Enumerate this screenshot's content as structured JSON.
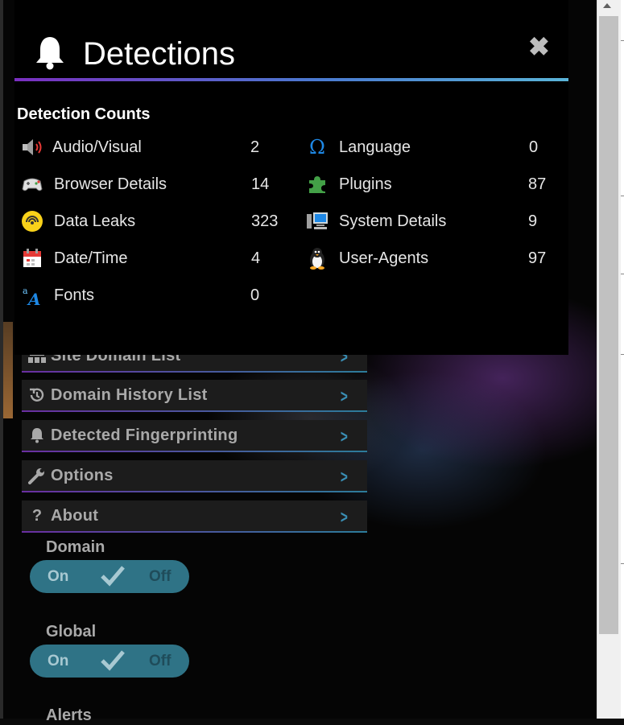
{
  "background_menu": {
    "items": [
      {
        "label": "Site Domain List",
        "icon": "sitemap-icon"
      },
      {
        "label": "Domain History List",
        "icon": "history-icon"
      },
      {
        "label": "Detected Fingerprinting",
        "icon": "bell-icon"
      },
      {
        "label": "Options",
        "icon": "wrench-icon"
      },
      {
        "label": "About",
        "icon": "question-icon"
      }
    ],
    "toggles": [
      {
        "label": "Domain",
        "on": "On",
        "off": "Off"
      },
      {
        "label": "Global",
        "on": "On",
        "off": "Off"
      }
    ],
    "cut_off_label": "Alerts"
  },
  "modal": {
    "title": "Detections",
    "close_symbol": "✖",
    "section_title": "Detection Counts",
    "left_column": [
      {
        "name": "Audio/Visual",
        "count": "2",
        "icon": "speaker-icon"
      },
      {
        "name": "Browser Details",
        "count": "14",
        "icon": "gamepad-icon"
      },
      {
        "name": "Data Leaks",
        "count": "323",
        "icon": "signal-icon"
      },
      {
        "name": "Date/Time",
        "count": "4",
        "icon": "calendar-icon"
      },
      {
        "name": "Fonts",
        "count": "0",
        "icon": "font-icon"
      }
    ],
    "right_column": [
      {
        "name": "Language",
        "count": "0",
        "icon": "omega-icon"
      },
      {
        "name": "Plugins",
        "count": "87",
        "icon": "puzzle-icon"
      },
      {
        "name": "System Details",
        "count": "9",
        "icon": "computer-icon"
      },
      {
        "name": "User-Agents",
        "count": "97",
        "icon": "penguin-icon"
      }
    ]
  }
}
